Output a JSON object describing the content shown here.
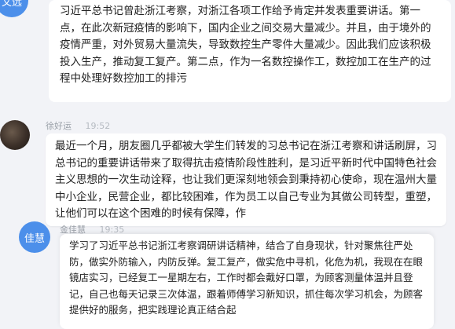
{
  "messages": [
    {
      "avatar": "文远",
      "name": "",
      "time": "",
      "text": "习近平总书记曾赴浙江考察，对浙江各项工作给予肯定并发表重要讲话。第一点，在此次新冠疫情的影响下，国内企业之间交易大量减少。并且，由于境外的疫情严重，对外贸易大量流失，导致数控生产零件大量减少。因此我们应该积极投入生产，推动复工复产。第二点，作为一名数控操作工，数控加工在生产的过程中处理好数控加工的排污"
    },
    {
      "avatar": "",
      "name": "徐好运",
      "time": "19:52",
      "text": "最近一个月，朋友圈几乎都被大学生们转发的习总书记在浙江考察和讲话刷屏，习总书记的重要讲话带来了取得抗击疫情阶段性胜利，是习近平新时代中国特色社会主义思想的一次生动诠释，也让我们更深刻地领会到秉持初心使命，现在温州大量中小企业，民营企业，都比较困难，作为员工以自己专业为其做公司转型，重塑，让他们可以在这个困难的时候有保障，作"
    },
    {
      "avatar": "佳慧",
      "name": "金佳慧",
      "time": "19:35",
      "text": "学习了习近平总书记浙江考察调研讲话精神，结合了自身现状，针对聚焦往严处防，做实外防输入，内防反弹。复工复产，做实危中寻机，化危为机，我现在在眼镜店实习，已经复工一星期左右，工作时都会戴好口罩，为顾客测量体温并且登记，自己也每天记录三次体温，跟着师傅学习新知识，抓住每次学习机会，为顾客提供好的服务，把实践理论真正结合起"
    }
  ],
  "colors": {
    "background": "#f2f3f7",
    "bubble": "#ffffff",
    "avatar_blue": "#4c8fea",
    "meta_text": "#9aa0a8"
  }
}
